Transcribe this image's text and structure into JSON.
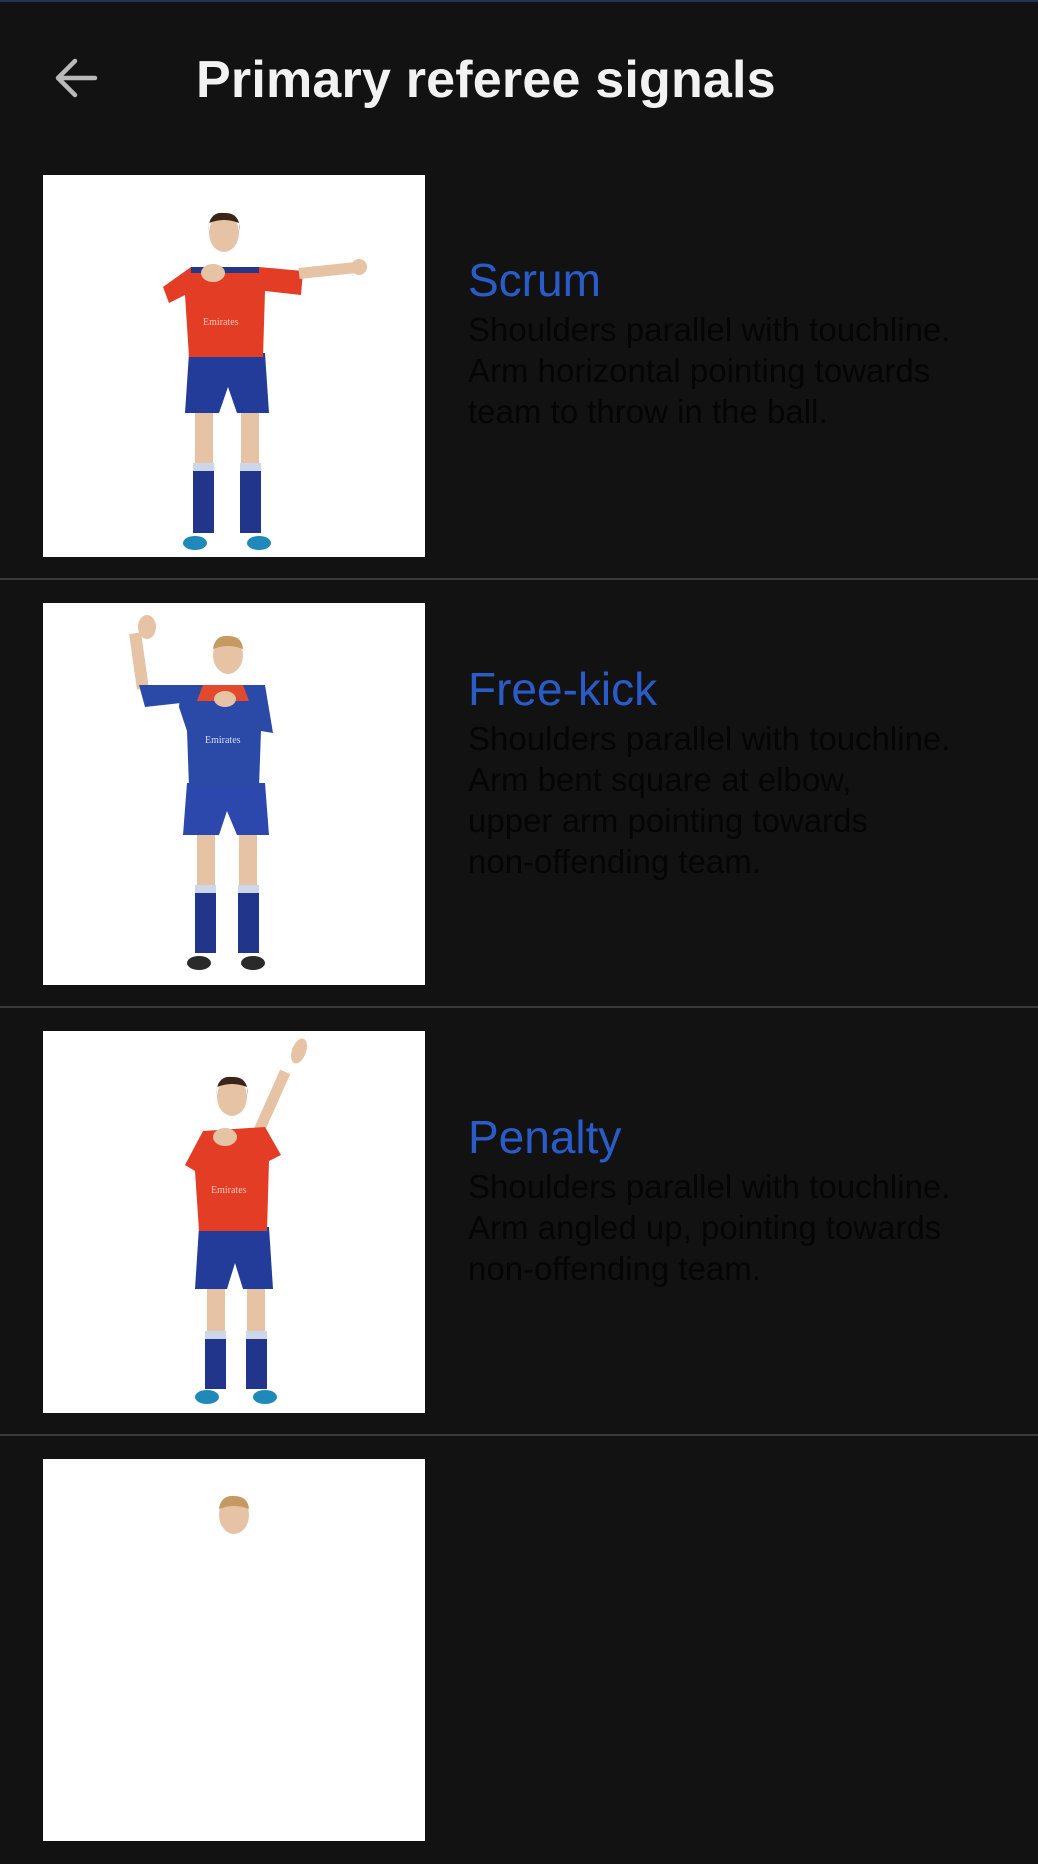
{
  "header": {
    "title": "Primary referee signals",
    "back_icon": "arrow-left-icon"
  },
  "colors": {
    "background": "#121212",
    "title": "#f2f2f2",
    "signal_name": "#2a5cc9",
    "signal_description": "#050505",
    "divider": "#3a3a3a"
  },
  "signals": [
    {
      "name": "Scrum",
      "description": "Shoulders parallel with touchline.\nArm horizontal pointing towards\nteam to throw in the ball.",
      "image": "referee-scrum-signal-photo"
    },
    {
      "name": "Free-kick",
      "description": "Shoulders parallel with touchline.\nArm bent square at elbow,\nupper arm pointing towards\nnon-offending team.",
      "image": "referee-free-kick-signal-photo"
    },
    {
      "name": "Penalty",
      "description": "Shoulders parallel with touchline.\nArm angled up, pointing towards\nnon-offending team.",
      "image": "referee-penalty-signal-photo"
    },
    {
      "name": "",
      "description": "",
      "image": "referee-signal-photo"
    }
  ]
}
